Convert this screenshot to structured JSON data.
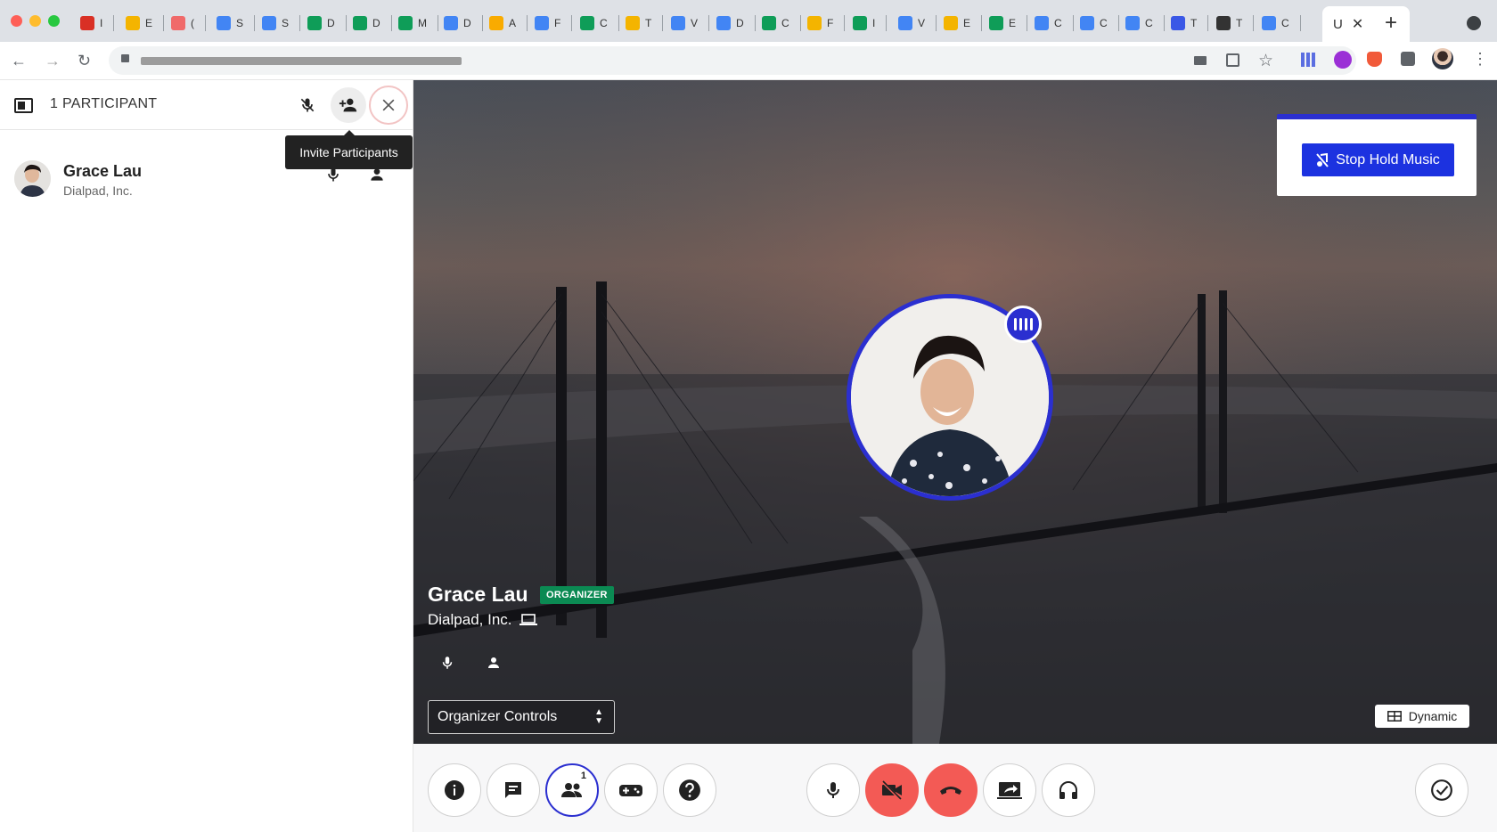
{
  "browser": {
    "active_tab_label": "U",
    "new_tab_label": "+",
    "tabs": [
      {
        "icon": "gmail-icon",
        "label": "I",
        "color": "#d93025"
      },
      {
        "icon": "slides-icon",
        "label": "E",
        "color": "#f4b400"
      },
      {
        "icon": "asana-icon",
        "label": "(",
        "color": "#f06a6a"
      },
      {
        "icon": "docs-icon",
        "label": "S",
        "color": "#4285f4"
      },
      {
        "icon": "docs-icon",
        "label": "S",
        "color": "#4285f4"
      },
      {
        "icon": "sheets-icon",
        "label": "D",
        "color": "#0f9d58"
      },
      {
        "icon": "sheets-icon",
        "label": "D",
        "color": "#0f9d58"
      },
      {
        "icon": "sheets-icon",
        "label": "M",
        "color": "#0f9d58"
      },
      {
        "icon": "calendar-icon",
        "label": "D",
        "color": "#4285f4"
      },
      {
        "icon": "analytics-icon",
        "label": "A",
        "color": "#f9ab00"
      },
      {
        "icon": "wifi-icon",
        "label": "F",
        "color": "#4285f4"
      },
      {
        "icon": "drive-icon",
        "label": "C",
        "color": "#0f9d58"
      },
      {
        "icon": "slides-icon",
        "label": "T",
        "color": "#f4b400"
      },
      {
        "icon": "docs-icon",
        "label": "V",
        "color": "#4285f4"
      },
      {
        "icon": "docs-icon",
        "label": "D",
        "color": "#4285f4"
      },
      {
        "icon": "sheets-icon",
        "label": "C",
        "color": "#0f9d58"
      },
      {
        "icon": "slides-icon",
        "label": "F",
        "color": "#f4b400"
      },
      {
        "icon": "sheets-icon",
        "label": "I",
        "color": "#0f9d58"
      },
      {
        "icon": "docs-icon",
        "label": "V",
        "color": "#4285f4"
      },
      {
        "icon": "slides-icon",
        "label": "E",
        "color": "#f4b400"
      },
      {
        "icon": "sheets-icon",
        "label": "E",
        "color": "#0f9d58"
      },
      {
        "icon": "docs-icon",
        "label": "C",
        "color": "#4285f4"
      },
      {
        "icon": "docs-icon",
        "label": "C",
        "color": "#4285f4"
      },
      {
        "icon": "docs-icon",
        "label": "C",
        "color": "#4285f4"
      },
      {
        "icon": "chat-icon",
        "label": "T",
        "color": "#3a58e6"
      },
      {
        "icon": "panda-icon",
        "label": "T",
        "color": "#333333"
      },
      {
        "icon": "google-icon",
        "label": "C",
        "color": "#4285f4"
      }
    ]
  },
  "sidebar": {
    "title": "1 PARTICIPANT",
    "tooltip": "Invite Participants",
    "participant": {
      "name": "Grace Lau",
      "company": "Dialpad, Inc."
    }
  },
  "stage": {
    "hold_music_button": "Stop Hold Music",
    "name": "Grace Lau",
    "role_badge": "ORGANIZER",
    "company": "Dialpad, Inc.",
    "organizer_controls": "Organizer Controls",
    "layout_button": "Dynamic"
  },
  "controls": {
    "participants_count": "1"
  },
  "colors": {
    "accent": "#2b2fd0",
    "end_call": "#f35a55",
    "organizer": "#0b8a53"
  }
}
